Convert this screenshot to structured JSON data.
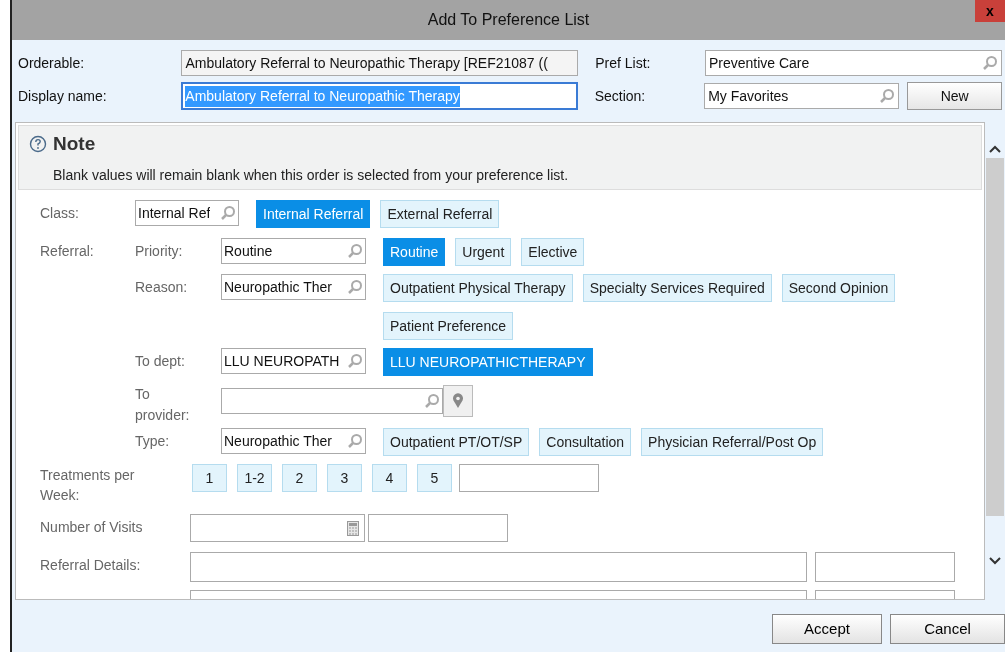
{
  "window": {
    "title": "Add To Preference List",
    "close": "x"
  },
  "header": {
    "orderable": {
      "label": "Orderable:",
      "value": "Ambulatory Referral to Neuropathic Therapy [REF21087 (("
    },
    "display_name": {
      "label": "Display name:",
      "value": "Ambulatory Referral to Neuropathic Therapy",
      "selected": true
    },
    "pref_list": {
      "label": "Pref List:",
      "value": "Preventive Care"
    },
    "section": {
      "label": "Section:",
      "value": "My Favorites"
    },
    "new_button": "New"
  },
  "note": {
    "title": "Note",
    "text": "Blank values will remain blank when this order is selected from your preference list."
  },
  "class": {
    "label": "Class:",
    "value": "Internal Ref",
    "options": [
      {
        "label": "Internal Referral",
        "selected": true
      },
      {
        "label": "External Referral",
        "selected": false
      }
    ]
  },
  "referral": {
    "label": "Referral:",
    "rows": [
      {
        "label": "Priority:",
        "value": "Routine",
        "options": [
          {
            "label": "Routine",
            "selected": true
          },
          {
            "label": "Urgent",
            "selected": false
          },
          {
            "label": "Elective",
            "selected": false
          }
        ]
      },
      {
        "label": "Reason:",
        "value": "Neuropathic Ther",
        "options": [
          {
            "label": "Outpatient Physical Therapy",
            "selected": false
          },
          {
            "label": "Specialty Services Required",
            "selected": false
          },
          {
            "label": "Second Opinion",
            "selected": false
          },
          {
            "label": "Patient Preference",
            "selected": false
          }
        ]
      },
      {
        "label": "To dept:",
        "value": "LLU NEUROPATH",
        "options": [
          {
            "label": "LLU NEUROPATHICTHERAPY",
            "selected": true
          }
        ]
      },
      {
        "label": "To provider:",
        "kind": "provider"
      },
      {
        "label": "Type:",
        "value": "Neuropathic Ther",
        "options": [
          {
            "label": "Outpatient PT/OT/SP",
            "selected": false
          },
          {
            "label": "Consultation",
            "selected": false
          },
          {
            "label": "Physician Referral/Post Op",
            "selected": false
          }
        ]
      }
    ]
  },
  "treatments": {
    "label": "Treatments per Week:",
    "options": [
      {
        "label": "1",
        "selected": false
      },
      {
        "label": "1-2",
        "selected": false
      },
      {
        "label": "2",
        "selected": false
      },
      {
        "label": "3",
        "selected": false
      },
      {
        "label": "4",
        "selected": false
      },
      {
        "label": "5",
        "selected": false
      }
    ]
  },
  "visits": {
    "label": "Number of Visits"
  },
  "details": {
    "label": "Referral Details:"
  },
  "buttons": {
    "accept": "Accept",
    "cancel": "Cancel"
  }
}
